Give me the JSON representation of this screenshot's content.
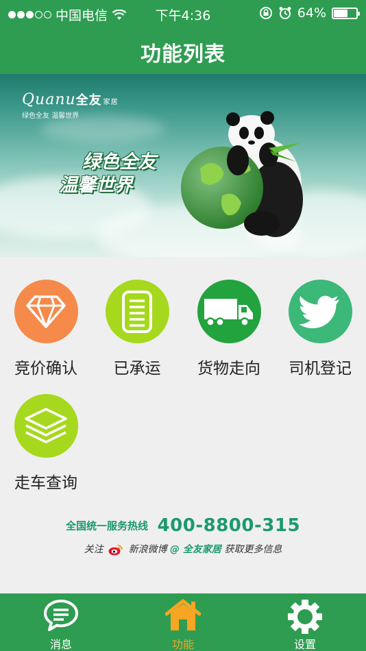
{
  "status_bar": {
    "carrier": "中国电信",
    "time": "下午4:36",
    "battery": "64%",
    "battery_level": 0.64,
    "signal_icon": "signal-dots-icon",
    "wifi_icon": "wifi-icon",
    "rotation_lock_icon": "rotation-lock-icon",
    "alarm_icon": "alarm-icon"
  },
  "header": {
    "title": "功能列表"
  },
  "banner": {
    "brand_latin": "Quanu",
    "brand_cn": "全友",
    "brand_sub": "家居",
    "tagline": "绿色全友 温馨世界",
    "slogan_line1": "绿色全友",
    "slogan_line2": "温馨世界",
    "image": "panda-hugging-earth"
  },
  "functions": [
    {
      "label": "竞价确认",
      "icon": "diamond-icon",
      "color": "#f58a4b"
    },
    {
      "label": "已承运",
      "icon": "document-list-icon",
      "color": "#a6d81d"
    },
    {
      "label": "货物走向",
      "icon": "truck-icon",
      "color": "#22a33d"
    },
    {
      "label": "司机登记",
      "icon": "bird-icon",
      "color": "#3cb878"
    },
    {
      "label": "走车查询",
      "icon": "layers-icon",
      "color": "#a6d81d"
    }
  ],
  "footer": {
    "hotline_label": "全国统一服务热线",
    "hotline_number": "400-8800-315",
    "follow_prefix": "关注",
    "weibo": "新浪微博",
    "account": "@ 全友家居",
    "follow_suffix": "获取更多信息"
  },
  "tabbar": {
    "tabs": [
      {
        "label": "消息",
        "icon": "chat-icon"
      },
      {
        "label": "功能",
        "icon": "home-icon",
        "active": true
      },
      {
        "label": "设置",
        "icon": "gear-icon"
      }
    ],
    "active_color": "#f6a623"
  }
}
